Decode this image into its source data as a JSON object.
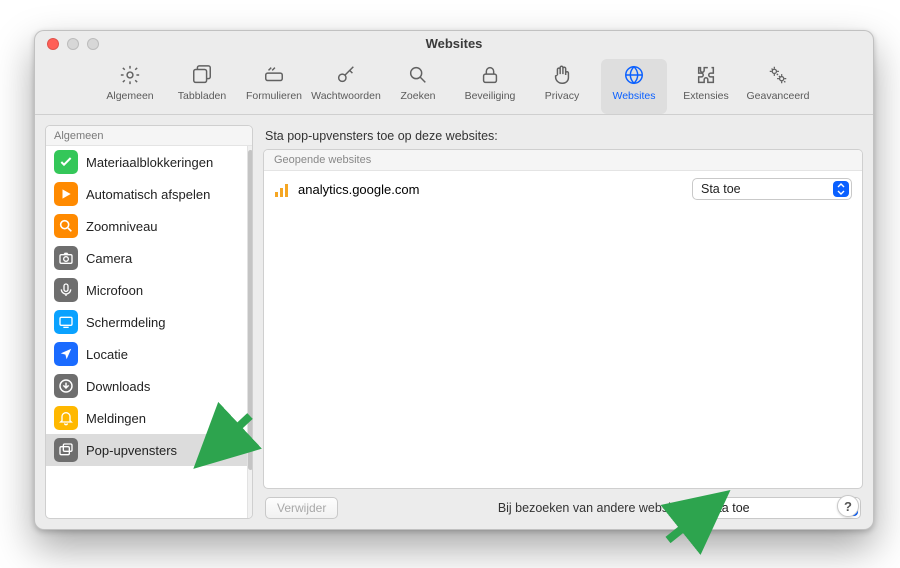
{
  "window": {
    "title": "Websites"
  },
  "toolbar": {
    "items": [
      {
        "label": "Algemeen",
        "icon": "gear"
      },
      {
        "label": "Tabbladen",
        "icon": "tabs"
      },
      {
        "label": "Formulieren",
        "icon": "form"
      },
      {
        "label": "Wachtwoorden",
        "icon": "key"
      },
      {
        "label": "Zoeken",
        "icon": "search"
      },
      {
        "label": "Beveiliging",
        "icon": "lock"
      },
      {
        "label": "Privacy",
        "icon": "hand"
      },
      {
        "label": "Websites",
        "icon": "globe",
        "active": true
      },
      {
        "label": "Extensies",
        "icon": "puzzle"
      },
      {
        "label": "Geavanceerd",
        "icon": "gears"
      }
    ]
  },
  "sidebar": {
    "header": "Algemeen",
    "items": [
      {
        "label": "Materiaalblokkeringen",
        "icon": "check",
        "bg": "#34c759"
      },
      {
        "label": "Automatisch afspelen",
        "icon": "play",
        "bg": "#ff8a00"
      },
      {
        "label": "Zoomniveau",
        "icon": "zoom",
        "bg": "#ff8a00"
      },
      {
        "label": "Camera",
        "icon": "camera",
        "bg": "#6e6e6e"
      },
      {
        "label": "Microfoon",
        "icon": "mic",
        "bg": "#6e6e6e"
      },
      {
        "label": "Schermdeling",
        "icon": "screen",
        "bg": "#0aa2ff"
      },
      {
        "label": "Locatie",
        "icon": "loc",
        "bg": "#1a6bff"
      },
      {
        "label": "Downloads",
        "icon": "dl",
        "bg": "#6e6e6e"
      },
      {
        "label": "Meldingen",
        "icon": "bell",
        "bg": "#ffb800"
      },
      {
        "label": "Pop-upvensters",
        "icon": "popup",
        "bg": "#6e6e6e",
        "selected": true
      }
    ]
  },
  "panel": {
    "title": "Sta pop-upvensters toe op deze websites:",
    "columnHeader": "Geopende websites",
    "rows": [
      {
        "site": "analytics.google.com",
        "value": "Sta toe"
      }
    ],
    "removeLabel": "Verwijder",
    "otherLabel": "Bij bezoeken van andere websites:",
    "otherValue": "Sta toe"
  },
  "helpLabel": "?"
}
